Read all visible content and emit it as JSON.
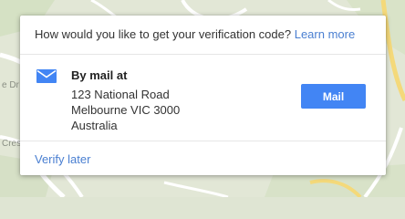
{
  "map": {
    "labels": [
      "e Dr",
      "Cres"
    ]
  },
  "dialog": {
    "question": "How would you like to get your verification code?",
    "learn_more": "Learn more",
    "method": {
      "icon": "mail-icon",
      "title": "By mail at",
      "address_lines": [
        "123 National Road",
        "Melbourne VIC 3000",
        "Australia"
      ]
    },
    "mail_button": "Mail",
    "verify_later": "Verify later"
  },
  "colors": {
    "accent": "#4285f4",
    "link": "#4a7fd1",
    "map_background": "#dfe5d3"
  }
}
